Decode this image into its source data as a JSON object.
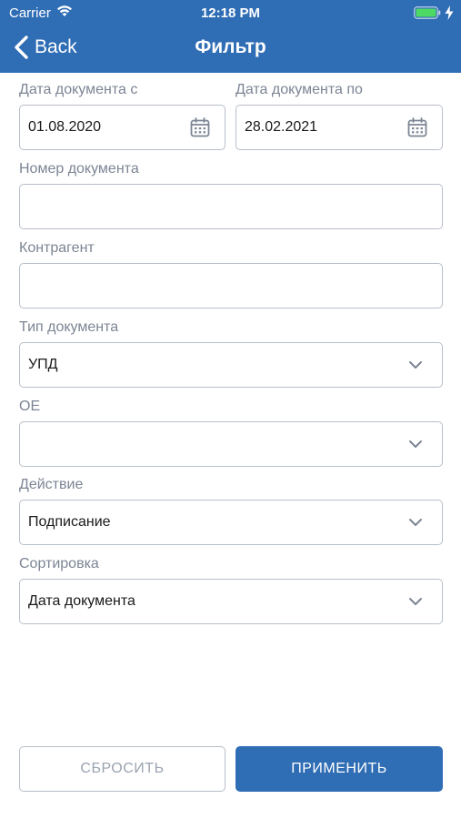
{
  "status_bar": {
    "carrier": "Carrier",
    "time": "12:18 PM"
  },
  "nav": {
    "back_label": "Back",
    "title": "Фильтр"
  },
  "form": {
    "date_from": {
      "label": "Дата документа с",
      "value": "01.08.2020"
    },
    "date_to": {
      "label": "Дата документа по",
      "value": "28.02.2021"
    },
    "doc_number": {
      "label": "Номер документа",
      "value": ""
    },
    "counterparty": {
      "label": "Контрагент",
      "value": ""
    },
    "doc_type": {
      "label": "Тип документа",
      "value": "УПД"
    },
    "oe": {
      "label": "ОЕ",
      "value": ""
    },
    "action": {
      "label": "Действие",
      "value": "Подписание"
    },
    "sorting": {
      "label": "Сортировка",
      "value": "Дата документа"
    }
  },
  "buttons": {
    "reset_label": "СБРОСИТЬ",
    "apply_label": "ПРИМЕНИТЬ"
  },
  "colors": {
    "brand": "#2f6db5",
    "label_gray": "#7c8594",
    "border": "#b7bec8"
  },
  "icons": {
    "calendar": "calendar-icon",
    "dropdown": "chevron-down-icon",
    "back": "chevron-left-icon"
  }
}
